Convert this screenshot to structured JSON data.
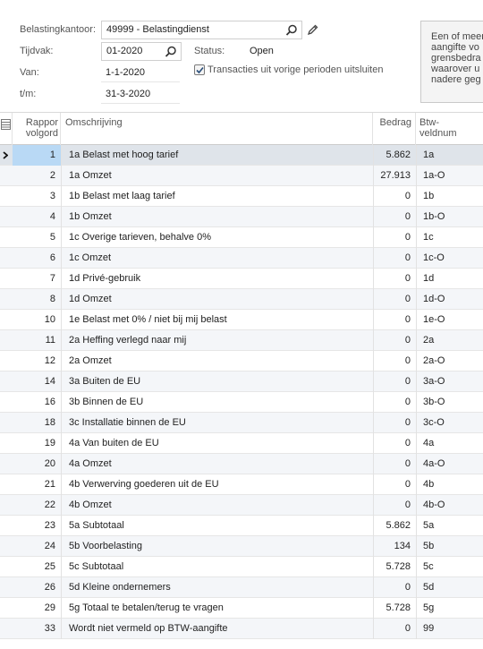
{
  "filter": {
    "belastingkantoor_label": "Belastingkantoor:",
    "belastingkantoor_value": "49999 - Belastingdienst",
    "tijdvak_label": "Tijdvak:",
    "tijdvak_value": "01-2020",
    "status_label": "Status:",
    "status_value": "Open",
    "van_label": "Van:",
    "van_value": "1-1-2020",
    "tm_label": "t/m:",
    "tm_value": "31-3-2020",
    "exclude_label": "Transacties uit vorige perioden uitsluiten",
    "exclude_checked": true
  },
  "info": {
    "lines": [
      "Een of meer",
      "aangifte vo",
      "grensbedra",
      "waarover u",
      "nadere geg"
    ]
  },
  "grid": {
    "columns": {
      "rapport": "Rappor\nvolgorde",
      "rapport_l1": "Rappor",
      "rapport_l2": "volgord",
      "omschrijving": "Omschrijving",
      "bedrag": "Bedrag",
      "btw_l1": "Btw-",
      "btw_l2": "veldnum"
    },
    "rows": [
      {
        "num": "1",
        "oms": "1a Belast met hoog tarief",
        "bedrag": "5.862",
        "btw": "1a"
      },
      {
        "num": "2",
        "oms": "1a Omzet",
        "bedrag": "27.913",
        "btw": "1a-O"
      },
      {
        "num": "3",
        "oms": "1b Belast met laag tarief",
        "bedrag": "0",
        "btw": "1b"
      },
      {
        "num": "4",
        "oms": "1b Omzet",
        "bedrag": "0",
        "btw": "1b-O"
      },
      {
        "num": "5",
        "oms": "1c Overige tarieven, behalve 0%",
        "bedrag": "0",
        "btw": "1c"
      },
      {
        "num": "6",
        "oms": "1c Omzet",
        "bedrag": "0",
        "btw": "1c-O"
      },
      {
        "num": "7",
        "oms": "1d Privé-gebruik",
        "bedrag": "0",
        "btw": "1d"
      },
      {
        "num": "8",
        "oms": "1d Omzet",
        "bedrag": "0",
        "btw": "1d-O"
      },
      {
        "num": "10",
        "oms": "1e Belast met 0% / niet bij mij belast",
        "bedrag": "0",
        "btw": "1e-O"
      },
      {
        "num": "11",
        "oms": "2a Heffing verlegd naar mij",
        "bedrag": "0",
        "btw": "2a"
      },
      {
        "num": "12",
        "oms": "2a Omzet",
        "bedrag": "0",
        "btw": "2a-O"
      },
      {
        "num": "14",
        "oms": "3a Buiten de EU",
        "bedrag": "0",
        "btw": "3a-O"
      },
      {
        "num": "16",
        "oms": "3b Binnen de EU",
        "bedrag": "0",
        "btw": "3b-O"
      },
      {
        "num": "18",
        "oms": "3c Installatie binnen de EU",
        "bedrag": "0",
        "btw": "3c-O"
      },
      {
        "num": "19",
        "oms": "4a Van buiten de EU",
        "bedrag": "0",
        "btw": "4a"
      },
      {
        "num": "20",
        "oms": "4a Omzet",
        "bedrag": "0",
        "btw": "4a-O"
      },
      {
        "num": "21",
        "oms": "4b Verwerving goederen uit de EU",
        "bedrag": "0",
        "btw": "4b"
      },
      {
        "num": "22",
        "oms": "4b Omzet",
        "bedrag": "0",
        "btw": "4b-O"
      },
      {
        "num": "23",
        "oms": "5a Subtotaal",
        "bedrag": "5.862",
        "btw": "5a"
      },
      {
        "num": "24",
        "oms": "5b Voorbelasting",
        "bedrag": "134",
        "btw": "5b"
      },
      {
        "num": "25",
        "oms": "5c Subtotaal",
        "bedrag": "5.728",
        "btw": "5c"
      },
      {
        "num": "26",
        "oms": "5d Kleine ondernemers",
        "bedrag": "0",
        "btw": "5d"
      },
      {
        "num": "29",
        "oms": "5g Totaal te betalen/terug te vragen",
        "bedrag": "5.728",
        "btw": "5g"
      },
      {
        "num": "33",
        "oms": "Wordt niet vermeld op BTW-aangifte",
        "bedrag": "0",
        "btw": "99"
      }
    ]
  }
}
